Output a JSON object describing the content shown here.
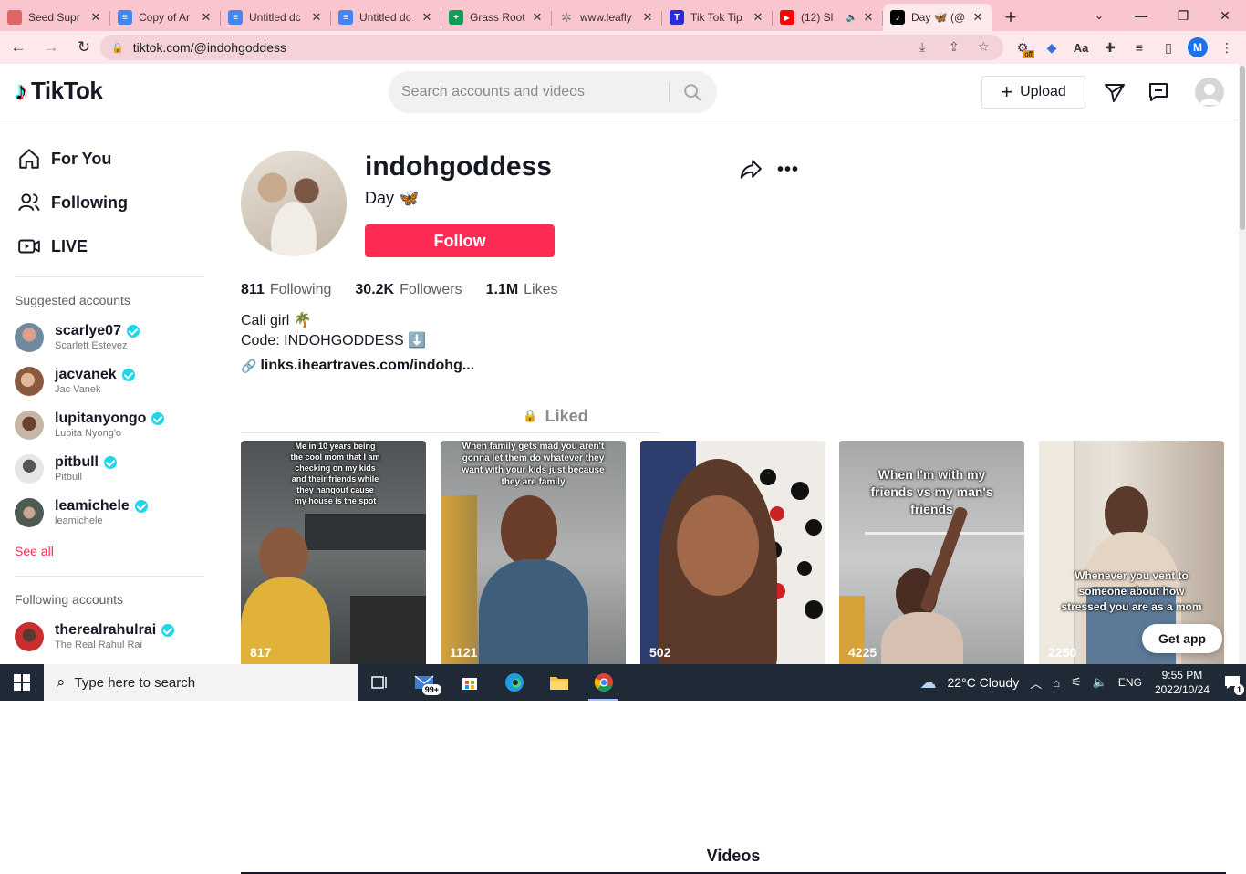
{
  "browser": {
    "tabs": [
      {
        "title": "Seed Supr",
        "favicon_color": "#e06666",
        "favicon_glyph": "",
        "icon": "doc-icon"
      },
      {
        "title": "Copy of Ar",
        "favicon_color": "#4285f4",
        "favicon_glyph": "",
        "icon": "google-docs-icon"
      },
      {
        "title": "Untitled dc",
        "favicon_color": "#4285f4",
        "favicon_glyph": "",
        "icon": "google-docs-icon"
      },
      {
        "title": "Untitled dc",
        "favicon_color": "#4285f4",
        "favicon_glyph": "",
        "icon": "google-docs-icon"
      },
      {
        "title": "Grass Root",
        "favicon_color": "#0f9d58",
        "favicon_glyph": "+",
        "icon": "google-sheets-icon"
      },
      {
        "title": "www.leafly",
        "favicon_color": "#777777",
        "favicon_glyph": "",
        "icon": "loading-icon"
      },
      {
        "title": "Tik Tok Tip",
        "favicon_color": "#2b2bd9",
        "favicon_glyph": "T",
        "icon": "site-icon"
      },
      {
        "title": "(12) Sl",
        "favicon_color": "#ff0000",
        "favicon_glyph": "▶",
        "icon": "youtube-icon"
      },
      {
        "title": "Day 🦋 (@",
        "favicon_color": "#000000",
        "favicon_glyph": "♪",
        "icon": "tiktok-icon"
      }
    ],
    "url": "tiktok.com/@indohgoddess",
    "profile_initial": "M"
  },
  "header": {
    "logo_text": "TikTok",
    "search_placeholder": "Search accounts and videos",
    "upload_label": "Upload"
  },
  "sidebar": {
    "nav": [
      {
        "label": "For You",
        "icon": "home-icon"
      },
      {
        "label": "Following",
        "icon": "users-icon"
      },
      {
        "label": "LIVE",
        "icon": "live-icon"
      }
    ],
    "suggested_title": "Suggested accounts",
    "suggested": [
      {
        "username": "scarlye07",
        "display": "Scarlett Estevez",
        "color": "#b07a6a"
      },
      {
        "username": "jacvanek",
        "display": "Jac Vanek",
        "color": "#c89a7a"
      },
      {
        "username": "lupitanyongo",
        "display": "Lupita Nyong'o",
        "color": "#6a4a3a"
      },
      {
        "username": "pitbull",
        "display": "Pitbull",
        "color": "#d8d8d8"
      },
      {
        "username": "leamichele",
        "display": "leamichele",
        "color": "#9a8a7a"
      }
    ],
    "see_all": "See all",
    "following_title": "Following accounts",
    "following": [
      {
        "username": "therealrahulrai",
        "display": "The Real Rahul Rai",
        "color": "#c83030"
      }
    ]
  },
  "profile": {
    "username": "indohgoddess",
    "nickname": "Day 🦋",
    "follow_label": "Follow",
    "stats": {
      "following_count": "811",
      "following_label": "Following",
      "followers_count": "30.2K",
      "followers_label": "Followers",
      "likes_count": "1.1M",
      "likes_label": "Likes"
    },
    "bio_line1": "Cali girl 🌴",
    "bio_line2": "Code: INDOHGODDESS ⬇️",
    "link": "links.iheartraves.com/indohg..."
  },
  "tabs": {
    "videos_label": "Videos",
    "liked_label": "Liked"
  },
  "videos": [
    {
      "caption": "Me in 10 years being the cool mom that I am checking on my kids and their friends while they hangout cause my house is the spot",
      "bg": "#5a5d5f",
      "plays": "817"
    },
    {
      "caption": "When family gets mad you aren't gonna let them do whatever they want with your kids just because they are family",
      "bg": "#9a9c9c",
      "plays": "1121"
    },
    {
      "caption": "",
      "bg": "#e8e6e2",
      "plays": "502"
    },
    {
      "caption": "When I'm with my friends vs my man's friends",
      "bg": "#b8b9b8",
      "plays": "4225"
    },
    {
      "caption": "Whenever you vent to someone about how stressed you are as a mom",
      "bg": "#c9bfb3",
      "plays": "2250"
    }
  ],
  "get_app_label": "Get app",
  "taskbar": {
    "search_placeholder": "Type here to search",
    "mail_badge": "99+",
    "weather": "22°C  Cloudy",
    "language": "ENG",
    "time": "9:55 PM",
    "date": "2022/10/24",
    "notification_count": "1"
  },
  "colors": {
    "tiktok_red": "#fe2c55",
    "verified": "#20d5ec",
    "tabbar": "#f9c6cf"
  }
}
